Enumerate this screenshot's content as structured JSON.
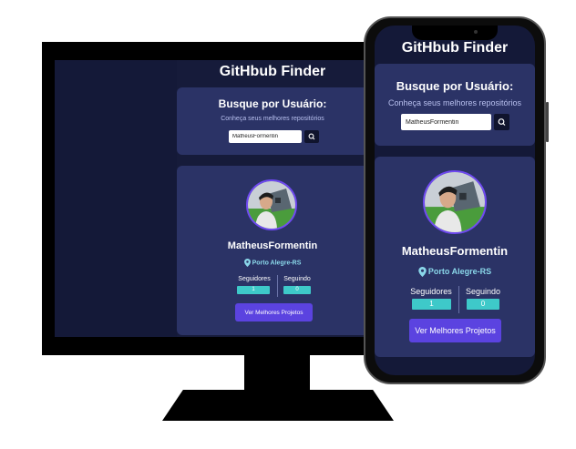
{
  "app": {
    "title": "GitHbub Finder"
  },
  "search": {
    "heading": "Busque por Usuário:",
    "subheading": "Conheça seus melhores repositórios",
    "value": "MatheusFormentin"
  },
  "profile": {
    "name": "MatheusFormentin",
    "location": "Porto Alegre-RS",
    "followers_label": "Seguidores",
    "followers_value": "1",
    "following_label": "Seguindo",
    "following_value": "0",
    "button_label": "Ver Melhores Projetos"
  },
  "icons": {
    "search": "search-icon",
    "location": "location-pin-icon",
    "avatar": "avatar-photo"
  },
  "colors": {
    "background": "#141938",
    "card": "#2b3366",
    "accent": "#5b43e0",
    "stat": "#3ec9c9",
    "avatar_border": "#6f49f2",
    "location": "#8ad7e9"
  }
}
